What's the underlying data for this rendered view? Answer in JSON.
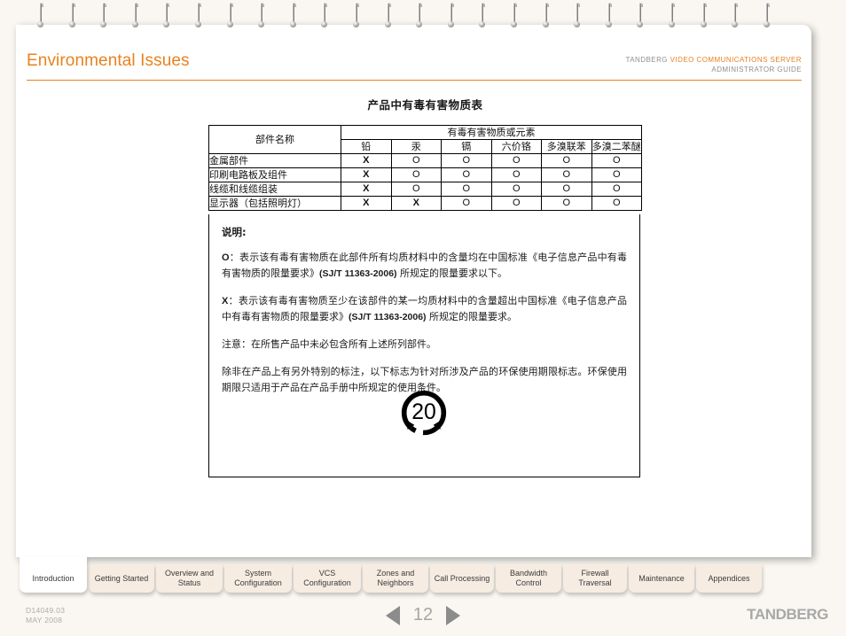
{
  "header": {
    "title": "Environmental Issues",
    "brand": "TANDBERG",
    "product": "VIDEO COMMUNICATIONS SERVER",
    "guide": "ADMINISTRATOR GUIDE",
    "accent_color": "#e8821e"
  },
  "document": {
    "title": "产品中有毒有害物质表",
    "table": {
      "part_header": "部件名称",
      "group_header": "有毒有害物质或元素",
      "substances": [
        "铅",
        "汞",
        "镉",
        "六价铬",
        "多溴联苯",
        "多溴二苯醚"
      ],
      "rows": [
        {
          "part": "金属部件",
          "marks": [
            "X",
            "O",
            "O",
            "O",
            "O",
            "O"
          ]
        },
        {
          "part": "印刷电路板及组件",
          "marks": [
            "X",
            "O",
            "O",
            "O",
            "O",
            "O"
          ]
        },
        {
          "part": "线缆和线缆组装",
          "marks": [
            "X",
            "O",
            "O",
            "O",
            "O",
            "O"
          ]
        },
        {
          "part": "显示器（包括照明灯）",
          "marks": [
            "X",
            "X",
            "O",
            "O",
            "O",
            "O"
          ]
        }
      ]
    },
    "notes": {
      "heading": "说明:",
      "o_lead": "O",
      "o_text_1": "：表示该有毒有害物质在此部件所有均质材料中的含量均在中国标准《电子信息产品中有毒有害物质的限量要求》",
      "o_standard": "(SJ/T 11363-2006)",
      "o_text_2": " 所规定的限量要求以下。",
      "x_lead": "X",
      "x_text_1": "：表示该有毒有害物质至少在该部件的某一均质材料中的含量超出中国标准《电子信息产品中有毒有害物质的限量要求》",
      "x_standard": "(SJ/T 11363-2006)",
      "x_text_2": " 所规定的限量要求。",
      "caution": "注意：在所售产品中未必包含所有上述所列部件。",
      "epup": "除非在产品上有另外特别的标注，以下标志为针对所涉及产品的环保使用期限标志。环保使用期限只适用于产品在产品手册中所规定的使用条件。"
    },
    "epup_symbol_value": "20"
  },
  "tabs": [
    {
      "label": "Introduction",
      "active": true
    },
    {
      "label": "Getting Started",
      "active": false
    },
    {
      "label": "Overview and Status",
      "active": false
    },
    {
      "label": "System Configuration",
      "active": false
    },
    {
      "label": "VCS Configuration",
      "active": false
    },
    {
      "label": "Zones and Neighbors",
      "active": false
    },
    {
      "label": "Call Processing",
      "active": false
    },
    {
      "label": "Bandwidth Control",
      "active": false
    },
    {
      "label": "Firewall Traversal",
      "active": false
    },
    {
      "label": "Maintenance",
      "active": false
    },
    {
      "label": "Appendices",
      "active": false
    }
  ],
  "footer": {
    "doc_id": "D14049.03",
    "doc_date": "MAY 2008",
    "page_number": "12",
    "prev_label": "◀",
    "next_label": "▶",
    "logo": "TANDBERG"
  }
}
